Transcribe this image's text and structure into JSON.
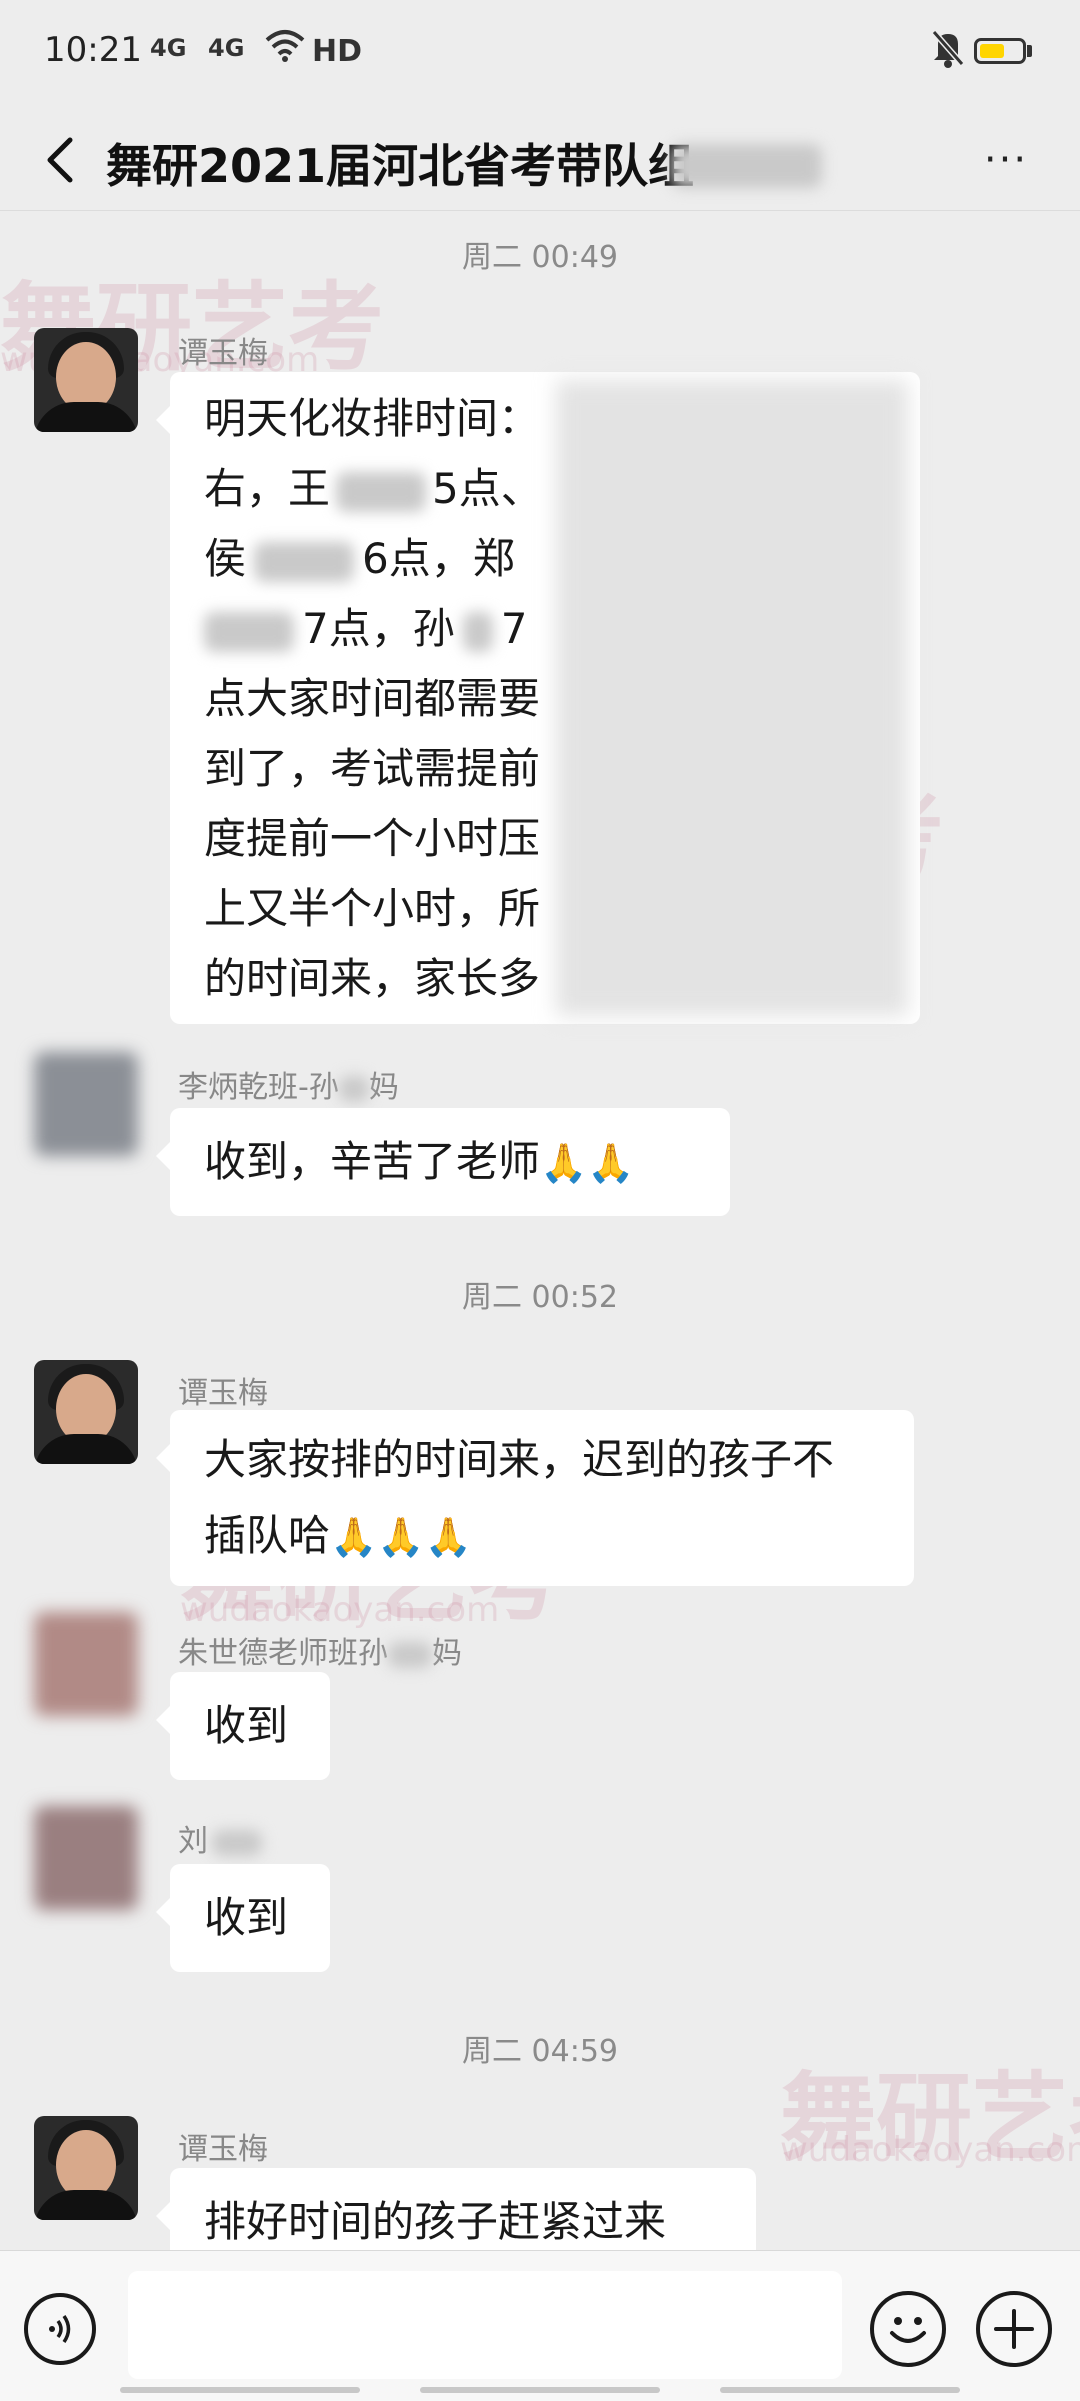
{
  "status": {
    "time": "10:21",
    "signal1": "4G",
    "signal2": "4G",
    "wifi_icon": "wifi-icon",
    "hd": "HD",
    "mute_icon": "bell-off-icon",
    "battery_level": 0.6,
    "battery_color": "#ffd500"
  },
  "header": {
    "title": "舞研2021届河北省考带队组",
    "back_icon": "chevron-left-icon",
    "more_icon": "more-icon",
    "more_label": "···"
  },
  "messages": [
    {
      "timestamp": "周二 00:49"
    },
    {
      "sender": "谭玉梅",
      "lines": [
        "明天化妆排时间：",
        "右，王",
        "5点、",
        "侯",
        "6点，郑",
        "7点，孙",
        "7",
        "点大家时间都需要",
        "到了，考试需提前",
        "度提前一个小时压",
        "上又半个小时，所",
        "的时间来，家长多"
      ]
    },
    {
      "sender": "李炳乾班-孙",
      "sender_suffix": "妈",
      "text": "收到，辛苦了老师",
      "emoji": "🙏🙏"
    },
    {
      "timestamp": "周二 00:52"
    },
    {
      "sender": "谭玉梅",
      "lines": [
        "大家按排的时间来，迟到的孩子不",
        "插队哈"
      ],
      "emoji": "🙏🙏🙏"
    },
    {
      "sender": "朱世德老师班孙",
      "sender_suffix": "妈",
      "text": "收到"
    },
    {
      "sender": "刘",
      "text": "收到"
    },
    {
      "timestamp": "周二 04:59"
    },
    {
      "sender": "谭玉梅",
      "text": "排好时间的孩子赶紧过来"
    }
  ],
  "watermark": {
    "brand": "舞研艺考",
    "url": "wudaokaoyan.com"
  },
  "inputbar": {
    "voice_icon": "voice-icon",
    "emoji_icon": "smiley-icon",
    "plus_icon": "plus-icon",
    "placeholder": ""
  }
}
